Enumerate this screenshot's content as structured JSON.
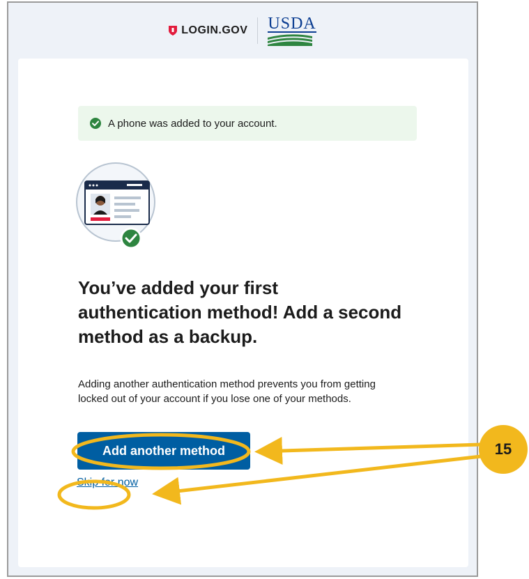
{
  "header": {
    "login_logo": "LOGIN.GOV",
    "partner_logo": "USDA"
  },
  "alert": {
    "message": "A phone was added to your account.",
    "icon": "check-circle-icon"
  },
  "main": {
    "heading": "You’ve added your first authentication method! Add a second method as a backup.",
    "description": "Adding another authentication method prevents you from getting locked out of your account if you lose one of your methods.",
    "primary_button": "Add another method",
    "skip_link": "Skip for now"
  },
  "annotation": {
    "step_number": "15"
  },
  "colors": {
    "primary": "#005ea2",
    "success": "#2e8540",
    "alert_bg": "#ecf7ec",
    "highlight": "#f2b81d",
    "logo_red": "#e21c3d"
  }
}
